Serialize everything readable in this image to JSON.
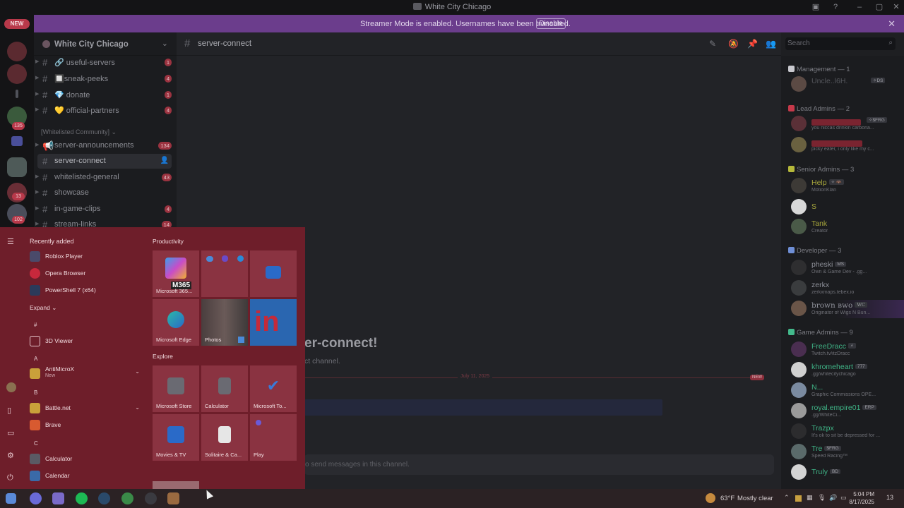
{
  "window": {
    "title": "White City Chicago"
  },
  "streamer": {
    "message": "Streamer Mode is enabled. Usernames have been truncated.",
    "button": "Disable",
    "close": "✕"
  },
  "rail": {
    "new_badge": "NEW",
    "badge_a": "135",
    "badge_b": "13",
    "badge_c": "102"
  },
  "guild": {
    "name": "White City Chicago"
  },
  "channels": {
    "items": [
      {
        "label": "🔗 useful-servers",
        "count": "1"
      },
      {
        "label": "🔲sneak-peeks",
        "count": "4"
      },
      {
        "label": "💎 donate",
        "count": "1"
      },
      {
        "label": "💛 official-partners",
        "count": "4"
      },
      {
        "label": "server-announcements",
        "count": "134"
      },
      {
        "label": "server-connect",
        "count": ""
      },
      {
        "label": "whitelisted-general",
        "count": "43"
      },
      {
        "label": "showcase",
        "count": ""
      },
      {
        "label": "in-game-clips",
        "count": "4"
      },
      {
        "label": "stream-links",
        "count": "14"
      }
    ],
    "category": "[Whitelisted Community] ⌄"
  },
  "chat": {
    "title": "server-connect",
    "search_placeholder": "Search",
    "welcome_title": "er-connect!",
    "welcome_sub": "ct channel.",
    "date": "July 11, 2025",
    "new_tag": "NEW",
    "composer_placeholder": "o send messages in this channel."
  },
  "members": {
    "roles": [
      {
        "label": "Management — 1",
        "color": "#c9c9cf"
      },
      {
        "label": "Lead Admins — 2",
        "color": "#c6394a"
      },
      {
        "label": "Senior Admins — 3",
        "color": "#b5b83a"
      },
      {
        "label": "Developer — 3",
        "color": "#6f8fd6"
      },
      {
        "label": "Game Admins — 9",
        "color": "#43b98b"
      }
    ],
    "list": [
      {
        "name": "Uncle..l6H.",
        "tag": "✧DS",
        "status": "",
        "color": "#55565c"
      },
      {
        "name": "",
        "tag": "✧$FRG",
        "status": "you niccas drinkin carbona...",
        "color": "#9b2d3a"
      },
      {
        "name": "",
        "tag": "",
        "status": "picky eater, i only like my c...",
        "color": "#9b2d3a"
      },
      {
        "name": "Help",
        "tag": "✧ 🦇",
        "status": "MotionKlan",
        "color": "#a7a63c"
      },
      {
        "name": "S",
        "tag": "",
        "status": "",
        "color": "#a7a63c"
      },
      {
        "name": "Tank",
        "tag": "",
        "status": "Creator",
        "color": "#a7a63c"
      },
      {
        "name": "pheski",
        "tag": "MS",
        "status": "Own & Game Dev - .gg...",
        "color": "#8e9099"
      },
      {
        "name": "zerkx",
        "tag": "",
        "status": "zerkxmaps.tebex.io",
        "color": "#8e9099"
      },
      {
        "name": "brown ʙᴡᴏ",
        "tag": "WC",
        "status": "Originator of Wigs N Bun...",
        "color": "#8e9099"
      },
      {
        "name": "FreeDracc",
        "tag": "⚡",
        "status": "Twitch.tv/itzDracc",
        "color": "#3fb587"
      },
      {
        "name": "khromeheart",
        "tag": "777",
        "status": ".gg/whitecitychicago",
        "color": "#3fb587"
      },
      {
        "name": "N...",
        "tag": "",
        "status": "Graphic Commissions OPE...",
        "color": "#3fb587"
      },
      {
        "name": "royal.empire01",
        "tag": "ERP",
        "status": ".gg/WhiteCi...",
        "color": "#3fb587"
      },
      {
        "name": "Trazpx",
        "tag": "",
        "status": "It's ok to sit be depressed for ...",
        "color": "#3fb587"
      },
      {
        "name": "Tre",
        "tag": "$FRG",
        "status": "Speed Racing™",
        "color": "#3fb587"
      },
      {
        "name": "Truly",
        "tag": "BD",
        "status": "",
        "color": "#3fb587"
      }
    ]
  },
  "start": {
    "recent_title": "Recently added",
    "recent": [
      "Roblox Player",
      "Opera Browser",
      "PowerShell 7 (x64)"
    ],
    "expand": "Expand ⌄",
    "letters": [
      "#",
      "A",
      "B",
      "C"
    ],
    "apps": [
      {
        "name": "3D Viewer",
        "sub": ""
      },
      {
        "name": "AntiMicroX",
        "sub": "New"
      },
      {
        "name": "Battle.net",
        "sub": ""
      },
      {
        "name": "Brave",
        "sub": ""
      },
      {
        "name": "Calculator",
        "sub": ""
      },
      {
        "name": "Calendar",
        "sub": ""
      }
    ],
    "productivity": "Productivity",
    "explore": "Explore",
    "tiles": [
      "Microsoft 365...",
      "",
      "",
      "Microsoft Edge",
      "Photos",
      "",
      "Microsoft Store",
      "Calculator",
      "Microsoft To...",
      "Movies & TV",
      "Solitaire & Ca...",
      "Play"
    ],
    "m365_badge": "M365"
  },
  "taskbar": {
    "temp": "63°F",
    "condition": "Mostly clear",
    "time": "5:04 PM",
    "date": "8/17/2025",
    "notif_count": "13"
  }
}
